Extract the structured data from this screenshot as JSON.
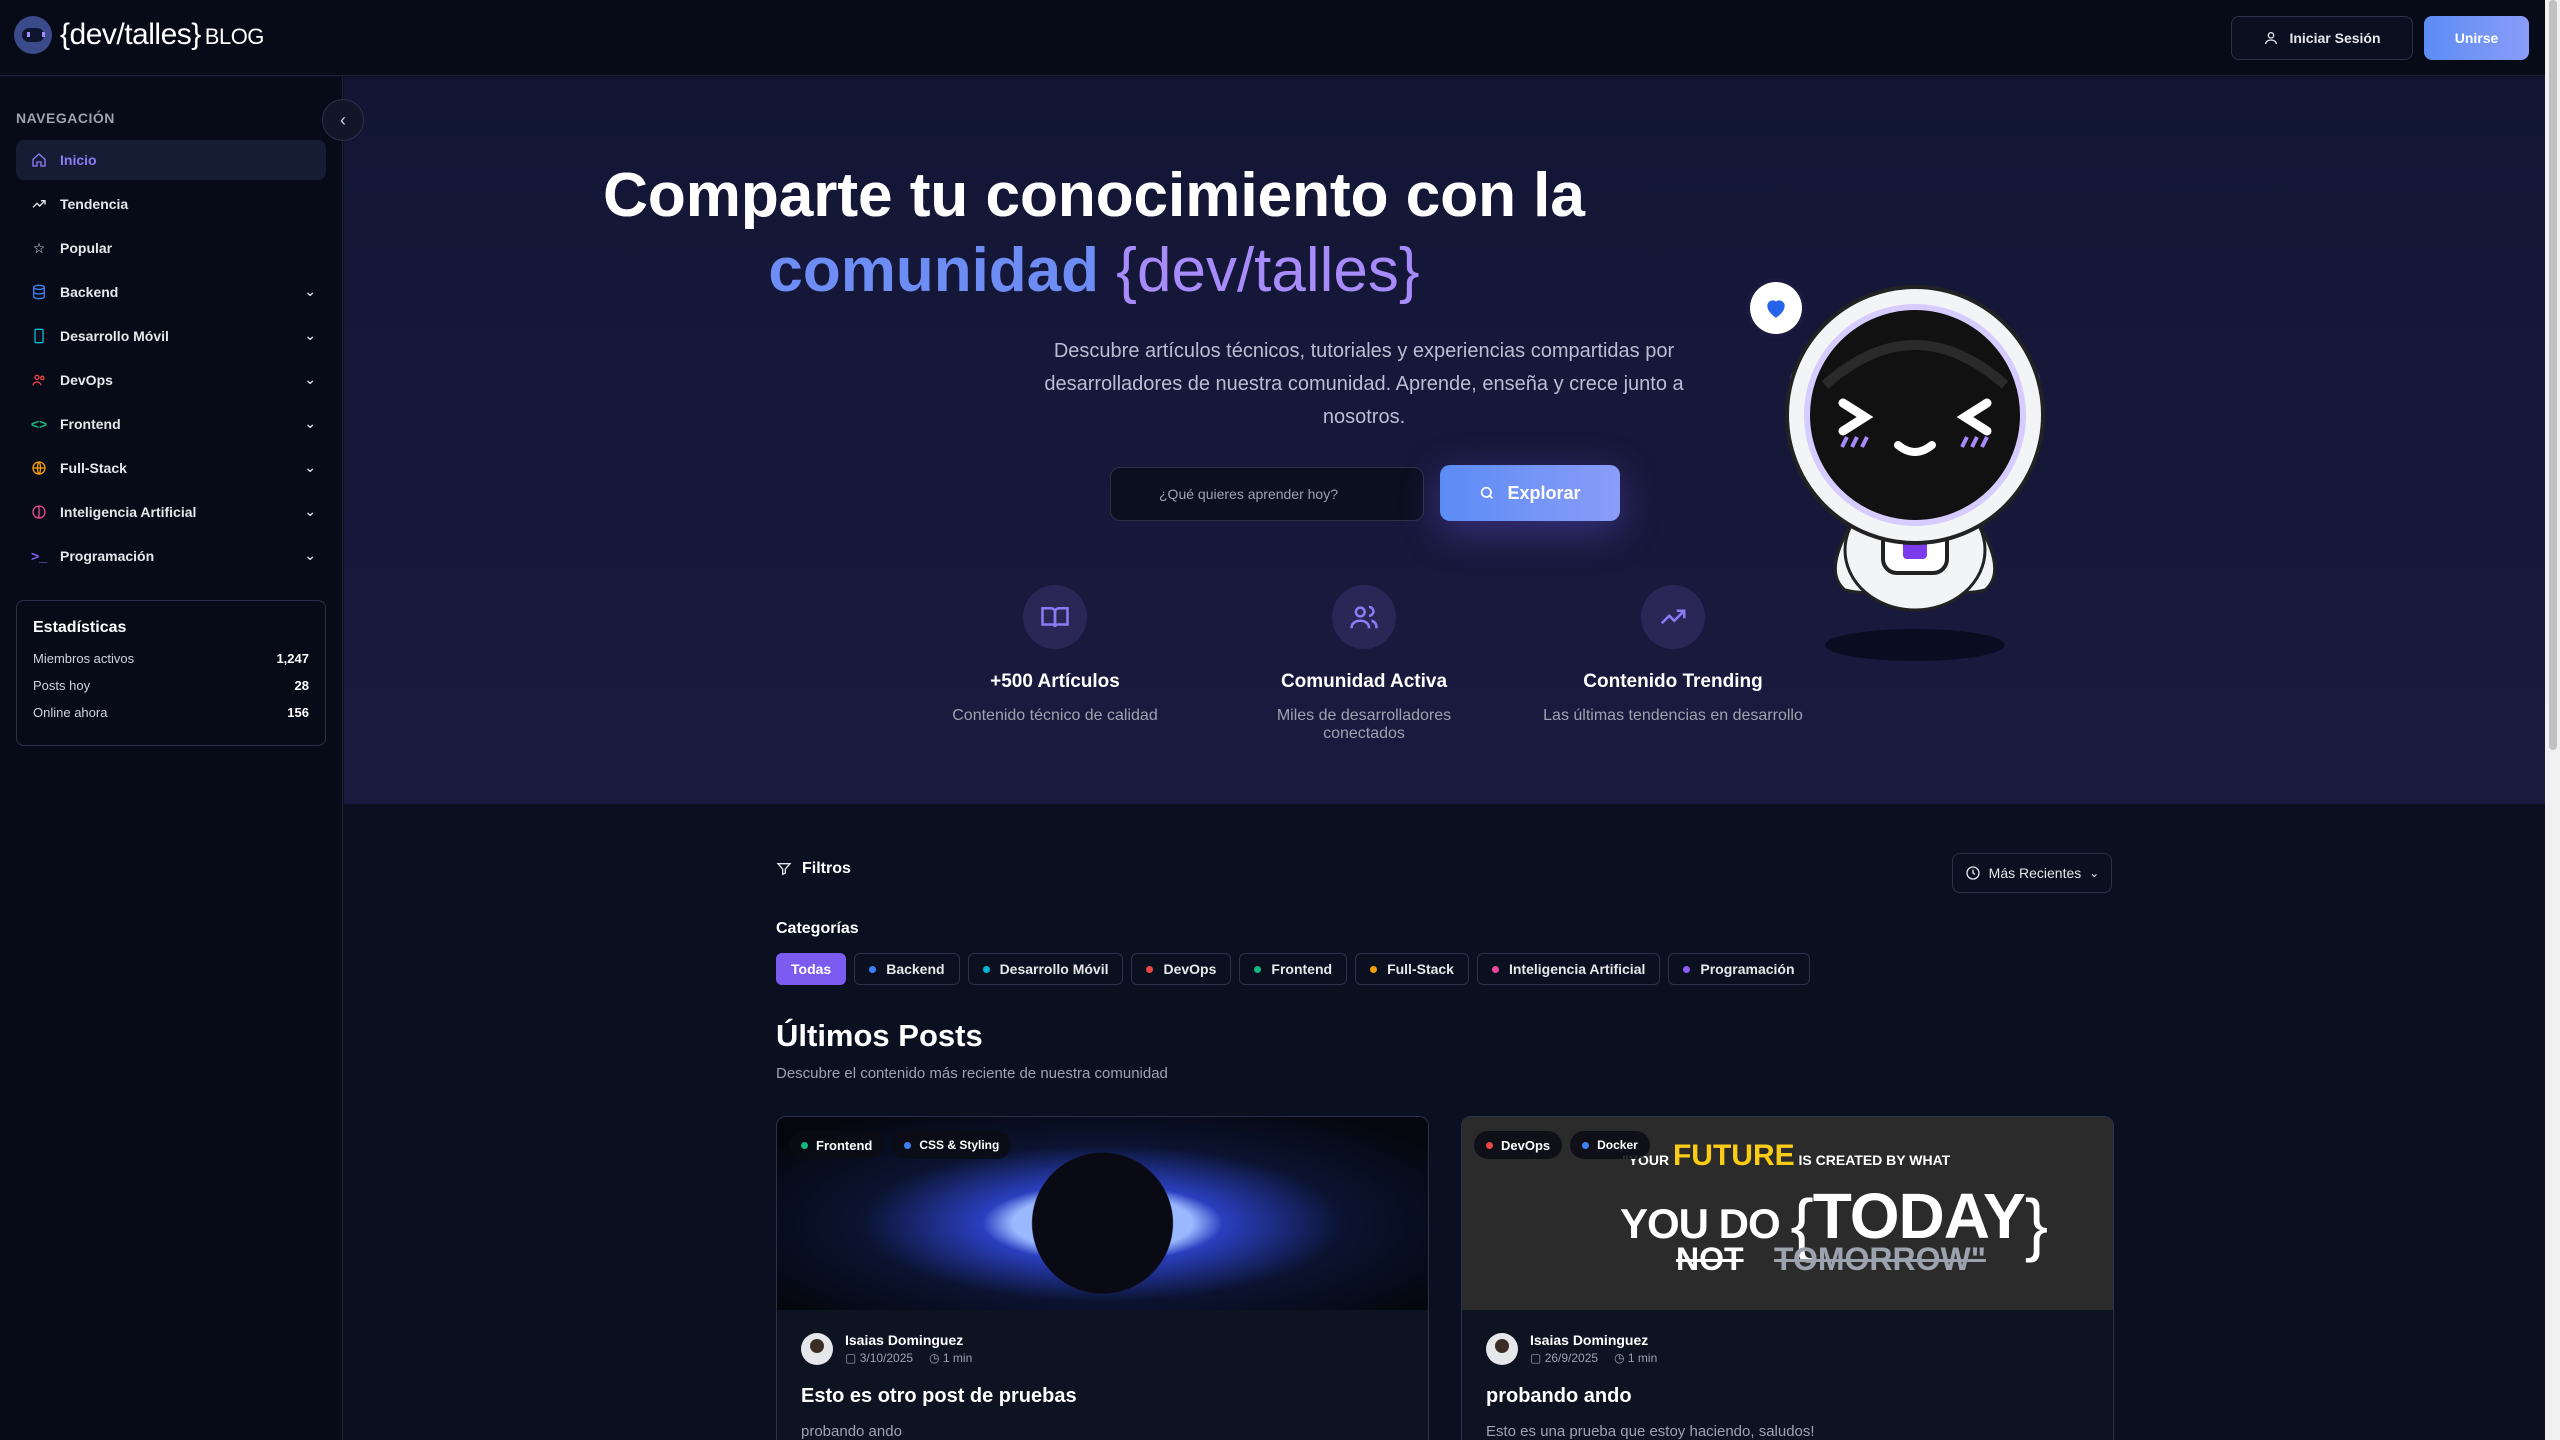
{
  "header": {
    "logo_text": "{dev/talles}",
    "logo_suffix": "BLOG",
    "login_label": "Iniciar Sesión",
    "join_label": "Unirse"
  },
  "sidebar": {
    "heading": "NAVEGACIÓN",
    "items": [
      {
        "label": "Inicio",
        "icon": "home-icon",
        "active": true
      },
      {
        "label": "Tendencia",
        "icon": "trending-icon"
      },
      {
        "label": "Popular",
        "icon": "star-icon"
      },
      {
        "label": "Backend",
        "icon": "database-icon",
        "expandable": true
      },
      {
        "label": "Desarrollo Móvil",
        "icon": "mobile-icon",
        "expandable": true
      },
      {
        "label": "DevOps",
        "icon": "users-icon",
        "expandable": true
      },
      {
        "label": "Frontend",
        "icon": "code-icon",
        "expandable": true
      },
      {
        "label": "Full-Stack",
        "icon": "globe-icon",
        "expandable": true
      },
      {
        "label": "Inteligencia Artificial",
        "icon": "brain-icon",
        "expandable": true
      },
      {
        "label": "Programación",
        "icon": "terminal-icon",
        "expandable": true
      }
    ],
    "stats": {
      "title": "Estadísticas",
      "rows": [
        {
          "label": "Miembros activos",
          "value": "1,247"
        },
        {
          "label": "Posts hoy",
          "value": "28"
        },
        {
          "label": "Online ahora",
          "value": "156"
        }
      ]
    }
  },
  "hero": {
    "title_line1": "Comparte tu conocimiento con la",
    "title_word": "comunidad",
    "title_brand": "{dev/talles}",
    "description": "Descubre artículos técnicos, tutoriales y experiencias compartidas por desarrolladores de nuestra comunidad. Aprende, enseña y crece junto a nosotros.",
    "search_placeholder": "¿Qué quieres aprender hoy?",
    "explore_label": "Explorar",
    "features": [
      {
        "title": "+500 Artículos",
        "desc": "Contenido técnico de calidad",
        "icon": "book-icon"
      },
      {
        "title": "Comunidad Activa",
        "desc": "Miles de desarrolladores conectados",
        "icon": "users-icon"
      },
      {
        "title": "Contenido Trending",
        "desc": "Las últimas tendencias en desarrollo",
        "icon": "trending-icon"
      }
    ]
  },
  "main": {
    "filters_label": "Filtros",
    "sort_label": "Más Recientes",
    "categories_title": "Categorías",
    "categories": [
      {
        "label": "Todas",
        "active": true,
        "color": "#7c5cf0"
      },
      {
        "label": "Backend",
        "color": "#3b82f6"
      },
      {
        "label": "Desarrollo Móvil",
        "color": "#06b6d4"
      },
      {
        "label": "DevOps",
        "color": "#ef4444"
      },
      {
        "label": "Frontend",
        "color": "#10b981"
      },
      {
        "label": "Full-Stack",
        "color": "#f59e0b"
      },
      {
        "label": "Inteligencia Artificial",
        "color": "#ec4899"
      },
      {
        "label": "Programación",
        "color": "#8b5cf6"
      }
    ],
    "posts_title": "Últimos Posts",
    "posts_subtitle": "Descubre el contenido más reciente de nuestra comunidad",
    "posts": [
      {
        "badges": [
          {
            "label": "Frontend",
            "color": "#10b981"
          },
          {
            "label": "CSS & Styling",
            "color": "#3b82f6"
          }
        ],
        "author": "Isaias Dominguez",
        "date": "3/10/2025",
        "read_time": "1 min",
        "title": "Esto es otro post de pruebas",
        "excerpt": "probando ando"
      },
      {
        "badges": [
          {
            "label": "DevOps",
            "color": "#ef4444"
          },
          {
            "label": "Docker",
            "color": "#3b82f6"
          }
        ],
        "author": "Isaias Dominguez",
        "date": "26/9/2025",
        "read_time": "1 min",
        "title": "probando ando",
        "excerpt": "Esto es una prueba que estoy haciendo, saludos!",
        "image_text": {
          "line1_a": "\"YOUR",
          "line1_b": "FUTURE",
          "line1_c": "IS CREATED BY WHAT",
          "line2_a": "YOU DO",
          "line2_b": "TODAY",
          "line3_a": "NOT",
          "line3_b": "TOMORROW\""
        }
      }
    ]
  }
}
